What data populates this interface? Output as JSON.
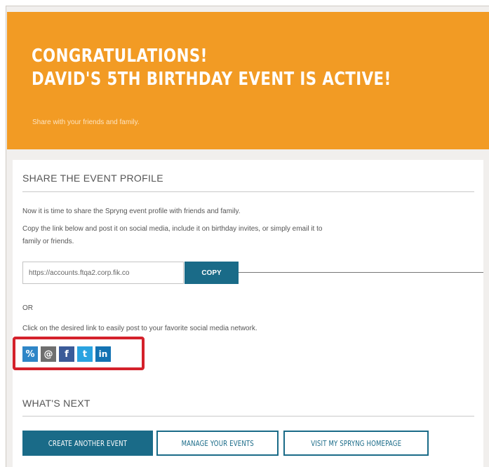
{
  "banner": {
    "line1": "CONGRATULATIONS!",
    "line2": "DAVID'S 5TH BIRTHDAY EVENT IS ACTIVE!",
    "subtitle": "Share with your friends and family."
  },
  "share": {
    "heading": "SHARE THE EVENT PROFILE",
    "intro": "Now it is time to share the Spryng event profile with friends and family.",
    "instructions_line1": "Copy the link below and post it on social media, include it on birthday invites, or simply email it to",
    "instructions_line2": "family or friends.",
    "link_value": "https://accounts.ftqa2.corp.fik.co",
    "copy_label": "COPY",
    "or_label": "OR",
    "social_prompt": "Click on the desired link to easily post to your favorite social media network.",
    "icons": {
      "link": "%",
      "email": "@",
      "facebook": "f",
      "twitter": "t",
      "linkedin": "in"
    }
  },
  "next": {
    "heading": "WHAT'S NEXT",
    "create_label": "CREATE ANOTHER EVENT",
    "manage_label": "MANAGE YOUR EVENTS",
    "visit_label": "VISIT MY SPRYNG HOMEPAGE"
  }
}
